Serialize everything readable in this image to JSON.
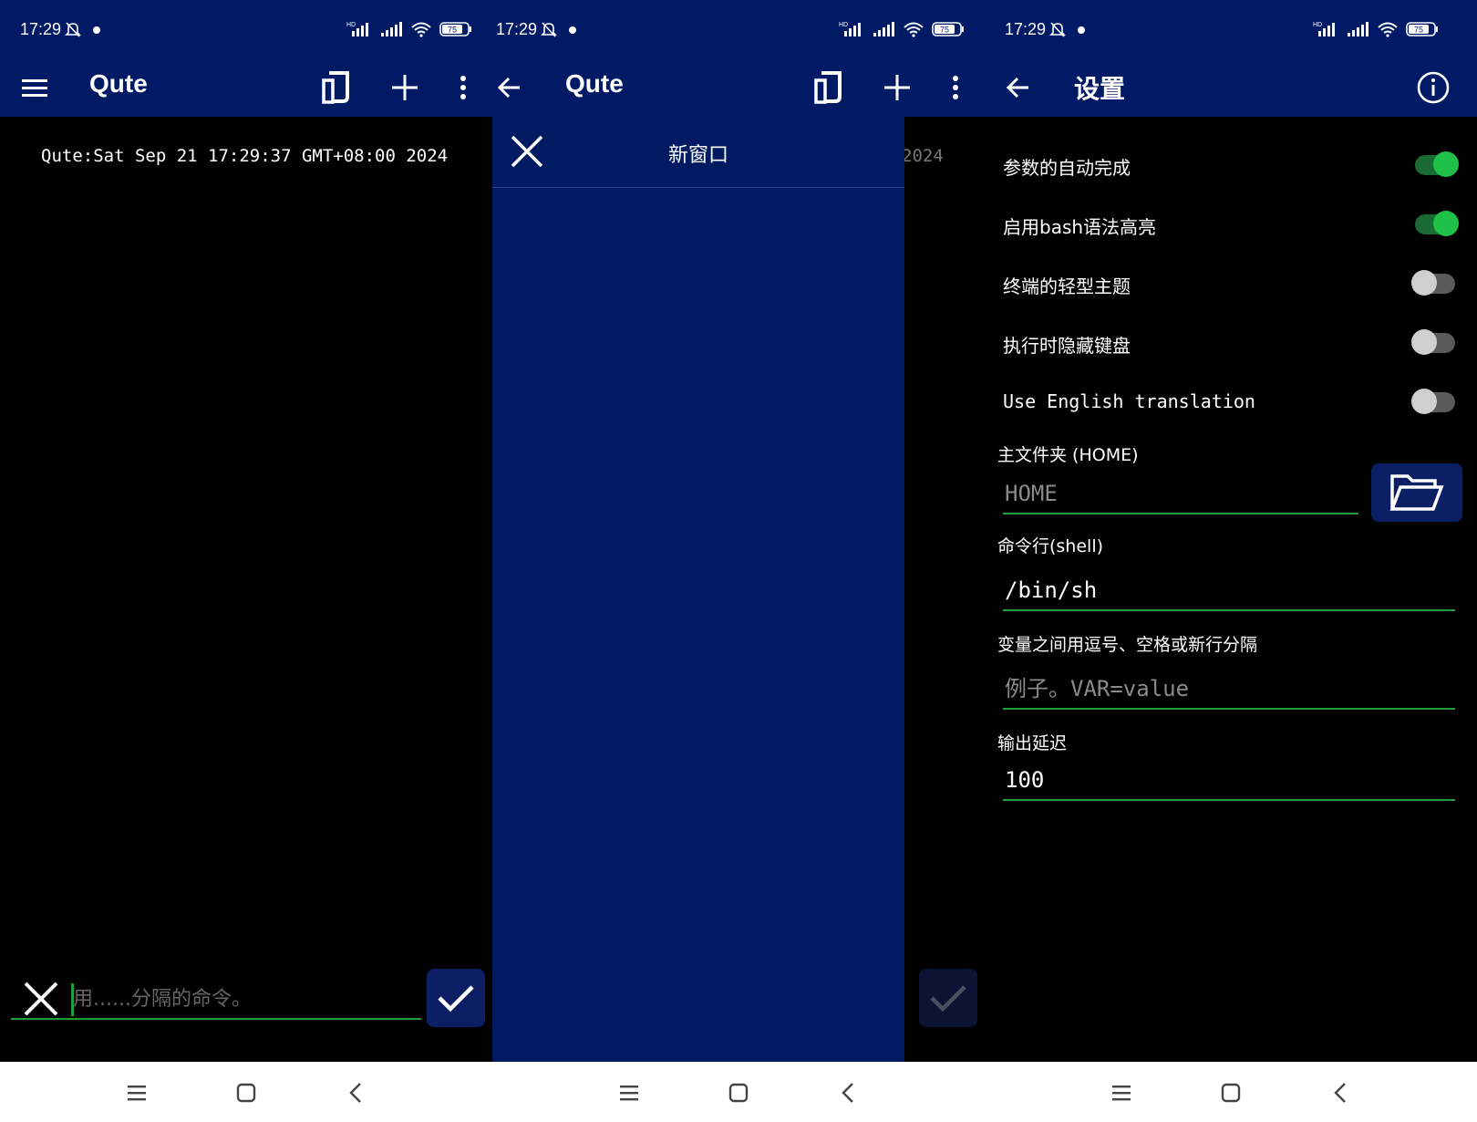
{
  "status": {
    "time": "17:29",
    "battery": "75"
  },
  "screen1": {
    "title": "Qute",
    "terminal_line": "Qute:Sat Sep 21 17:29:37 GMT+08:00 2024",
    "command_placeholder": "用......分隔的命令。"
  },
  "screen2": {
    "title": "Qute",
    "drawer_title": "新窗口",
    "bleed_text": "2024"
  },
  "screen3": {
    "title": "设置",
    "settings": [
      {
        "label": "参数的自动完成",
        "state": "on"
      },
      {
        "label": "启用bash语法高亮",
        "state": "on"
      },
      {
        "label": "终端的轻型主题",
        "state": "off"
      },
      {
        "label": "执行时隐藏键盘",
        "state": "off"
      },
      {
        "label": "Use English translation",
        "state": "off"
      }
    ],
    "home_label": "主文件夹 (HOME)",
    "home_placeholder": "HOME",
    "shell_label": "命令行(shell)",
    "shell_value": "/bin/sh",
    "env_label": "变量之间用逗号、空格或新行分隔",
    "env_placeholder": "例子。VAR=value",
    "delay_label": "输出延迟",
    "delay_value": "100"
  },
  "colors": {
    "bar": "#001a66",
    "drawer": "#011b63",
    "accent_green": "#1fc14a",
    "underline": "#1f9d3a",
    "button_bg": "#0c1f64"
  }
}
